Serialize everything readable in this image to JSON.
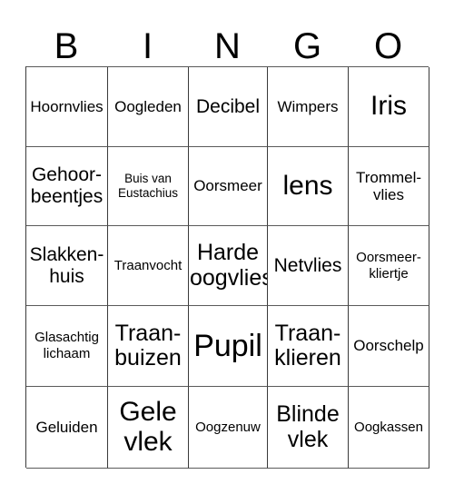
{
  "card": {
    "type": "bingo-card",
    "columns": 5,
    "rows": 5,
    "header_letters": [
      "B",
      "I",
      "N",
      "G",
      "O"
    ],
    "border_color": "#3a3a3a",
    "background_color": "#ffffff",
    "text_color": "#000000",
    "cells": [
      [
        {
          "text": "Hoornvlies",
          "size": "md"
        },
        {
          "text": "Oogleden",
          "size": "md"
        },
        {
          "text": "Decibel",
          "size": "lg"
        },
        {
          "text": "Wimpers",
          "size": "md"
        },
        {
          "text": "Iris",
          "size": "2xl"
        }
      ],
      [
        {
          "text": "Gehoor-\nbeentjes",
          "size": "lg"
        },
        {
          "text": "Buis van\nEustachius",
          "size": "xs"
        },
        {
          "text": "Oorsmeer",
          "size": "md"
        },
        {
          "text": "lens",
          "size": "2xl"
        },
        {
          "text": "Trommel-\nvlies",
          "size": "md"
        }
      ],
      [
        {
          "text": "Slakken-\nhuis",
          "size": "lg"
        },
        {
          "text": "Traanvocht",
          "size": "sm"
        },
        {
          "text": "Harde\noogvlies",
          "size": "xl"
        },
        {
          "text": "Netvlies",
          "size": "lg"
        },
        {
          "text": "Oorsmeer-\nkliertje",
          "size": "sm"
        }
      ],
      [
        {
          "text": "Glasachtig\nlichaam",
          "size": "sm"
        },
        {
          "text": "Traan-\nbuizen",
          "size": "xl"
        },
        {
          "text": "Pupil",
          "size": "3xl"
        },
        {
          "text": "Traan-\nklieren",
          "size": "xl"
        },
        {
          "text": "Oorschelp",
          "size": "md"
        }
      ],
      [
        {
          "text": "Geluiden",
          "size": "md"
        },
        {
          "text": "Gele\nvlek",
          "size": "2xl"
        },
        {
          "text": "Oogzenuw",
          "size": "sm"
        },
        {
          "text": "Blinde\nvlek",
          "size": "xl"
        },
        {
          "text": "Oogkassen",
          "size": "sm"
        }
      ]
    ]
  }
}
